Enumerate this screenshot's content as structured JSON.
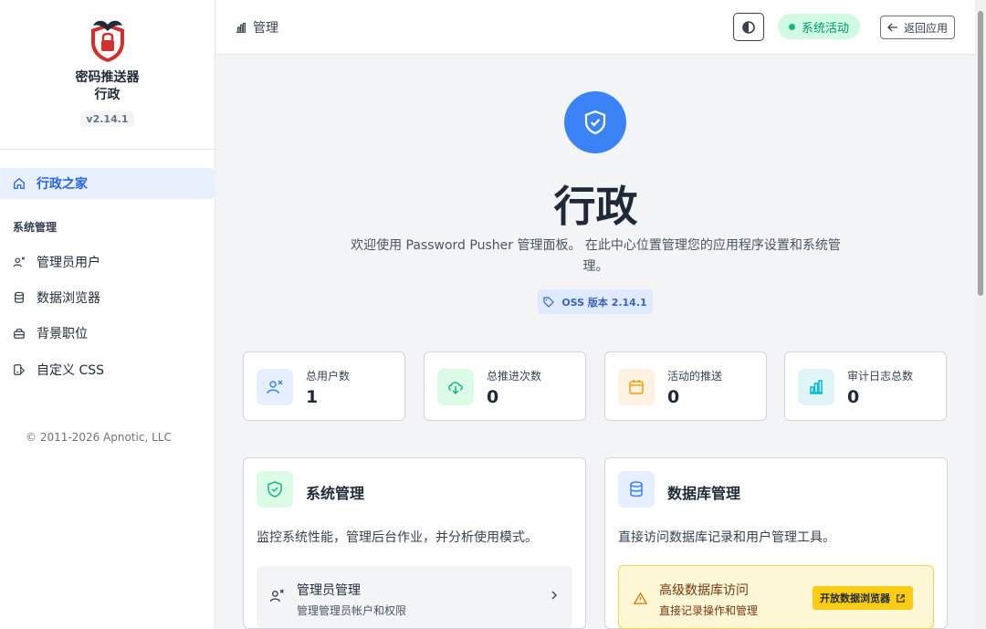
{
  "sidebar": {
    "brand_line1": "密码推送器",
    "brand_line2": "行政",
    "version": "v2.14.1",
    "home_label": "行政之家",
    "section_label": "系统管理",
    "items": [
      {
        "label": "管理员用户",
        "icon": "user-cog-icon"
      },
      {
        "label": "数据浏览器",
        "icon": "database-icon"
      },
      {
        "label": "背景职位",
        "icon": "briefcase-icon"
      },
      {
        "label": "自定义 CSS",
        "icon": "palette-icon"
      }
    ],
    "copyright": "© 2011-2026 Apnotic, LLC"
  },
  "topbar": {
    "breadcrumb": "管理",
    "status": "系统活动",
    "back_label": "返回应用"
  },
  "hero": {
    "title": "行政",
    "description": "欢迎使用 Password Pusher 管理面板。 在此中心位置管理您的应用程序设置和系统管理。",
    "badge": "OSS 版本 2.14.1"
  },
  "stats": [
    {
      "label": "总用户数",
      "value": "1",
      "color": "#3b82f6",
      "bg": "#e6efff"
    },
    {
      "label": "总推进次数",
      "value": "0",
      "color": "#10b981",
      "bg": "#dcfce7"
    },
    {
      "label": "活动的推送",
      "value": "0",
      "color": "#f59e0b",
      "bg": "#fef3e2"
    },
    {
      "label": "审计日志总数",
      "value": "0",
      "color": "#06b6d4",
      "bg": "#dff5f8"
    }
  ],
  "panels": {
    "system": {
      "title": "系统管理",
      "description": "监控系统性能，管理后台作业，并分析使用模式。",
      "sub_title": "管理员管理",
      "sub_desc": "管理管理员帐户和权限"
    },
    "database": {
      "title": "数据库管理",
      "description": "直接访问数据库记录和用户管理工具。",
      "warn_title": "高级数据库访问",
      "warn_desc": "直接记录操作和管理",
      "warn_button": "开放数据浏览器"
    }
  },
  "colors": {
    "accent": "#2563eb",
    "success": "#059669",
    "warning": "#facc15"
  }
}
